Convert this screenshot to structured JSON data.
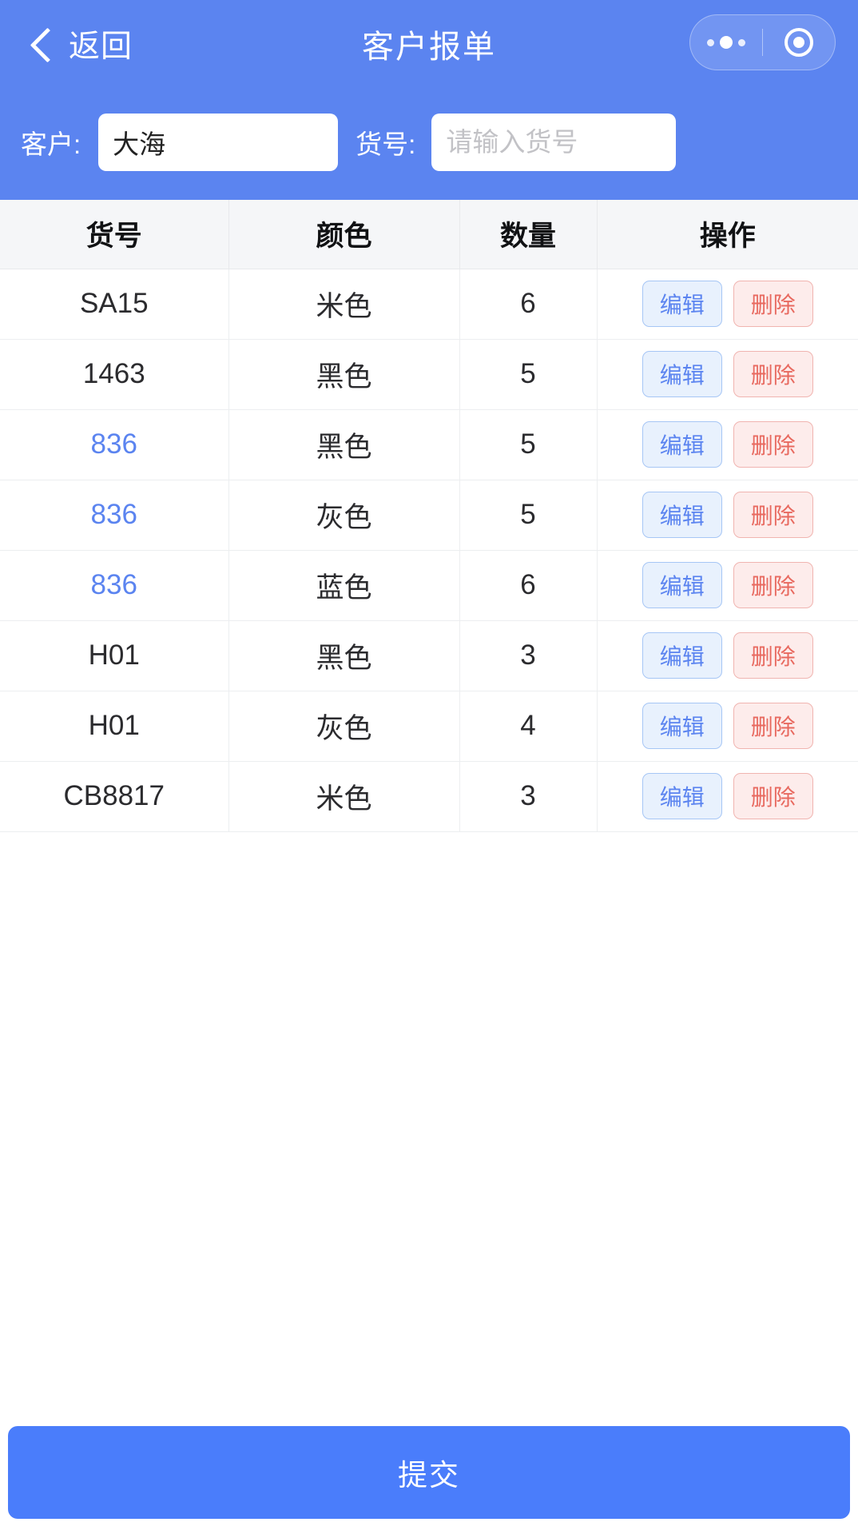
{
  "navbar": {
    "back_label": "返回",
    "title": "客户报单",
    "back_icon": "chevron-left-icon",
    "more_icon": "more-dots-icon",
    "target_icon": "target-circle-icon",
    "background_color": "#5b84f0"
  },
  "filter": {
    "customer_label": "客户:",
    "customer_value": "大海",
    "customer_placeholder": "",
    "code_label": "货号:",
    "code_value": "",
    "code_placeholder": "请输入货号"
  },
  "table": {
    "columns": [
      "货号",
      "颜色",
      "数量",
      "操作"
    ],
    "edit_label": "编辑",
    "delete_label": "删除",
    "link_color": "#5b84f0",
    "rows": [
      {
        "code": "SA15",
        "color": "米色",
        "qty": "6",
        "is_link": false
      },
      {
        "code": "1463",
        "color": "黑色",
        "qty": "5",
        "is_link": false
      },
      {
        "code": "836",
        "color": "黑色",
        "qty": "5",
        "is_link": true
      },
      {
        "code": "836",
        "color": "灰色",
        "qty": "5",
        "is_link": true
      },
      {
        "code": "836",
        "color": "蓝色",
        "qty": "6",
        "is_link": true
      },
      {
        "code": "H01",
        "color": "黑色",
        "qty": "3",
        "is_link": false
      },
      {
        "code": "H01",
        "color": "灰色",
        "qty": "4",
        "is_link": false
      },
      {
        "code": "CB8817",
        "color": "米色",
        "qty": "3",
        "is_link": false
      }
    ]
  },
  "footer": {
    "submit_label": "提交",
    "submit_color": "#4a7dfb"
  }
}
